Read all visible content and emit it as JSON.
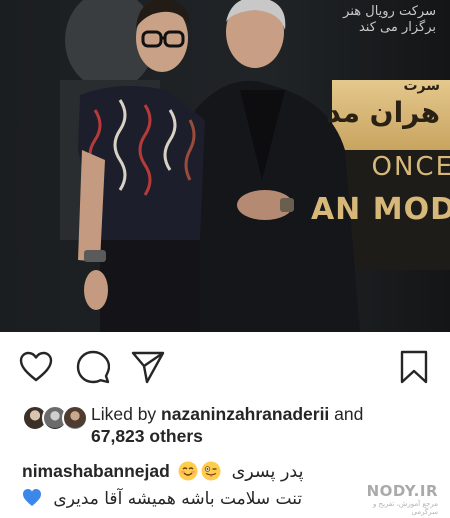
{
  "post": {
    "photo": {
      "banner_top_line1": "سرکت رویال هنر",
      "banner_top_line2": "برگزار می کند",
      "banner_gold_sub": "سرت",
      "banner_gold_title": "هران مد",
      "banner_once": "ONCE",
      "banner_mod": "AN MOD"
    },
    "actions": {
      "like_icon": "heart-outline-icon",
      "comment_icon": "speech-bubble-icon",
      "share_icon": "paper-plane-icon",
      "save_icon": "bookmark-icon"
    },
    "likes": {
      "prefix": "Liked by ",
      "user": "nazaninzahranaderii",
      "and": " and",
      "others": "67,823 others"
    },
    "caption": {
      "username": "nimashabannejad",
      "line1_text": "پدر پسری",
      "line2_text": "تنت سلامت باشه همیشه آقا مدیری"
    },
    "watermark": {
      "text": "NODY.IR",
      "sub": "مرجع آموزش، تفریح و سرگرمی"
    }
  },
  "colors": {
    "text": "#262626",
    "gold_banner": "#d7b879",
    "blue_heart": "#3b88e8",
    "emoji_yellow": "#ffcc4d"
  }
}
